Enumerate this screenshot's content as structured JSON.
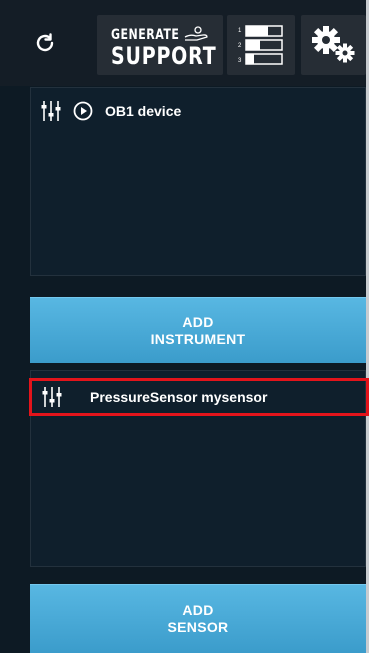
{
  "toolbar": {
    "refresh_icon": "refresh-icon",
    "generate_label": "GENERATE",
    "support_label": "SUPPORT",
    "list_icon": "numbered-list-icon",
    "settings_icon": "gears-icon"
  },
  "instruments": {
    "items": [
      {
        "label": "OB1 device",
        "icons": [
          "mixer-sliders-icon",
          "play-circle-icon"
        ]
      }
    ],
    "add_button": {
      "line1": "ADD",
      "line2": "INSTRUMENT"
    }
  },
  "sensors": {
    "items": [
      {
        "label": "PressureSensor mysensor",
        "icons": [
          "mixer-sliders-icon"
        ],
        "selected": true
      }
    ],
    "add_button": {
      "line1": "ADD",
      "line2": "SENSOR"
    }
  },
  "colors": {
    "background": "#0d1a24",
    "panel": "#0f1f2c",
    "toolbar_button": "#262d35",
    "accent_button": "#4aaad8",
    "selection_border": "#e3141b"
  }
}
